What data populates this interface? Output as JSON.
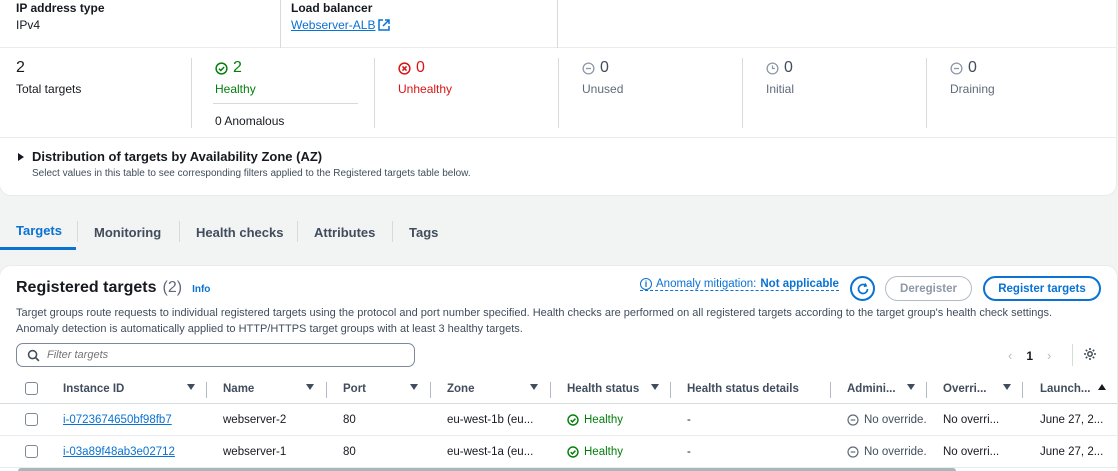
{
  "details": {
    "ip_type_label": "IP address type",
    "ip_type_value": "IPv4",
    "lb_label": "Load balancer",
    "lb_value": "Webserver-ALB"
  },
  "counts": {
    "total": {
      "value": "2",
      "label": "Total targets"
    },
    "healthy": {
      "value": "2",
      "label": "Healthy"
    },
    "anomalous": "0 Anomalous",
    "unhealthy": {
      "value": "0",
      "label": "Unhealthy"
    },
    "unused": {
      "value": "0",
      "label": "Unused"
    },
    "initial": {
      "value": "0",
      "label": "Initial"
    },
    "draining": {
      "value": "0",
      "label": "Draining"
    }
  },
  "distribution": {
    "title": "Distribution of targets by Availability Zone (AZ)",
    "description": "Select values in this table to see corresponding filters applied to the Registered targets table below."
  },
  "tabs": [
    "Targets",
    "Monitoring",
    "Health checks",
    "Attributes",
    "Tags"
  ],
  "registered": {
    "title": "Registered targets",
    "count": "(2)",
    "info": "Info",
    "description": "Target groups route requests to individual registered targets using the protocol and port number specified. Health checks are performed on all registered targets according to the target group's health check settings. Anomaly detection is automatically applied to HTTP/HTTPS target groups with at least 3 healthy targets.",
    "anomaly_prefix": "Anomaly mitigation:",
    "anomaly_value": "Not applicable",
    "deregister": "Deregister",
    "register": "Register targets",
    "search_placeholder": "Filter targets",
    "page": "1"
  },
  "table": {
    "headers": [
      "Instance ID",
      "Name",
      "Port",
      "Zone",
      "Health status",
      "Health status details",
      "Admini...",
      "Overri...",
      "Launch..."
    ],
    "rows": [
      {
        "instance": "i-0723674650bf98fb7",
        "name": "webserver-2",
        "port": "80",
        "zone": "eu-west-1b (eu...",
        "health": "Healthy",
        "details": "-",
        "admin": "No override.",
        "override": "No overri...",
        "launch": "June 27, 2..."
      },
      {
        "instance": "i-03a89f48ab3e02712",
        "name": "webserver-1",
        "port": "80",
        "zone": "eu-west-1a (eu...",
        "health": "Healthy",
        "details": "-",
        "admin": "No override.",
        "override": "No overri...",
        "launch": "June 27, 2..."
      }
    ]
  },
  "colors": {
    "accent": "#0972d3",
    "healthy": "#037f0c",
    "unhealthy": "#d91515"
  }
}
